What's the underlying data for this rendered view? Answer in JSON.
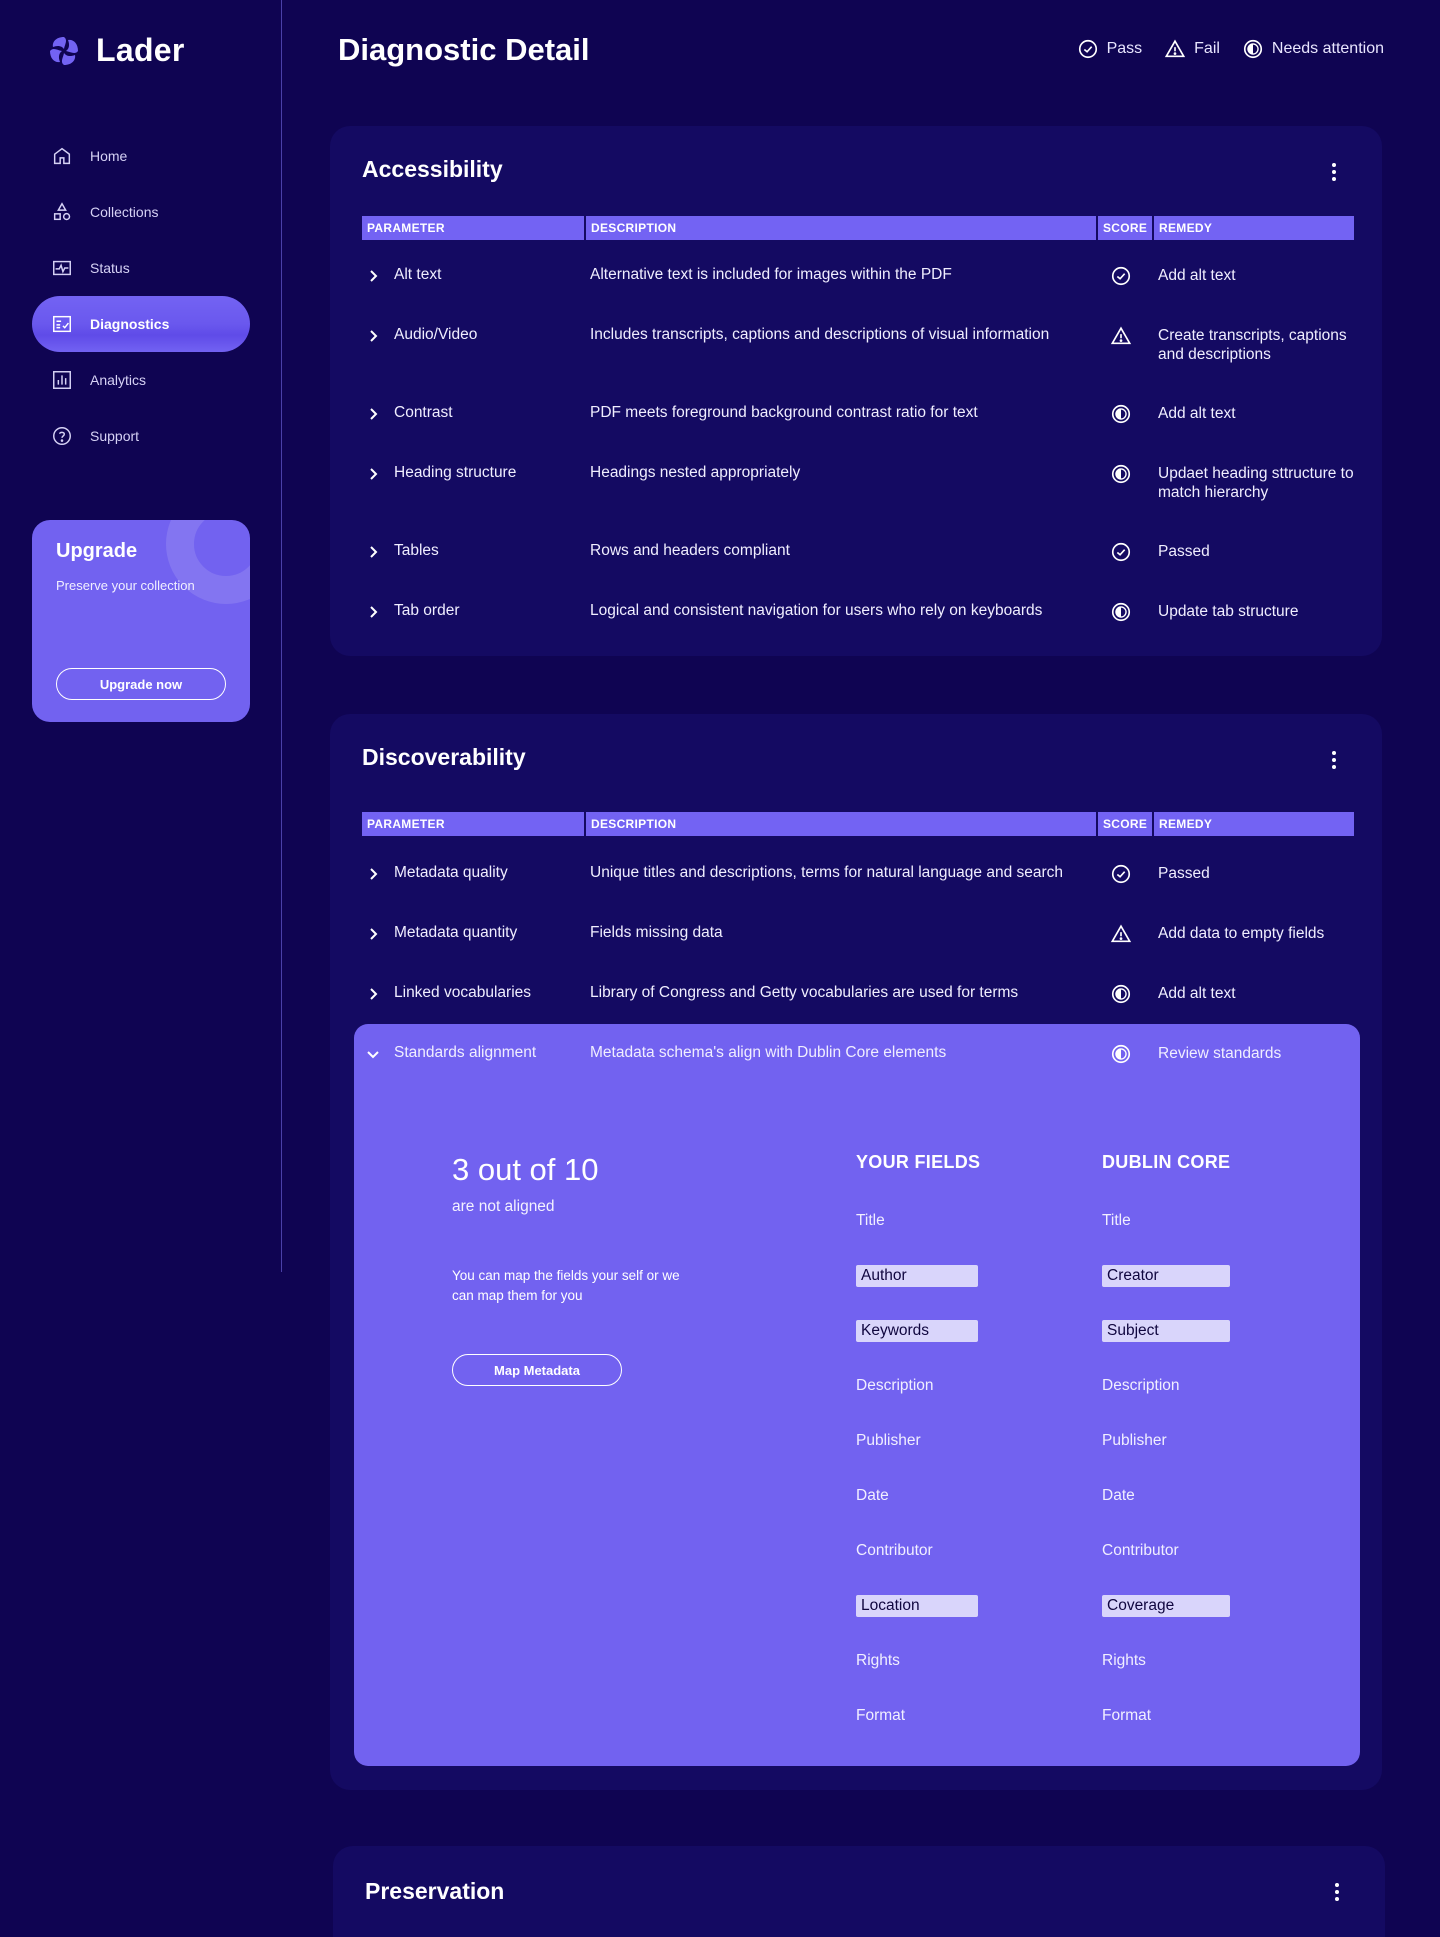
{
  "brand": {
    "name": "Lader"
  },
  "nav": [
    {
      "label": "Home",
      "icon": "home-icon",
      "active": false
    },
    {
      "label": "Collections",
      "icon": "shapes-icon",
      "active": false
    },
    {
      "label": "Status",
      "icon": "activity-icon",
      "active": false
    },
    {
      "label": "Diagnostics",
      "icon": "checklist-icon",
      "active": true
    },
    {
      "label": "Analytics",
      "icon": "bar-chart-icon",
      "active": false
    },
    {
      "label": "Support",
      "icon": "help-icon",
      "active": false
    }
  ],
  "upgrade": {
    "title": "Upgrade",
    "subtitle": "Preserve your collection",
    "button": "Upgrade now"
  },
  "header": {
    "title": "Diagnostic Detail",
    "legend": [
      {
        "label": "Pass",
        "icon": "check-circle-icon"
      },
      {
        "label": "Fail",
        "icon": "warning-triangle-icon"
      },
      {
        "label": "Needs attention",
        "icon": "half-circle-icon"
      }
    ]
  },
  "columns": {
    "parameter": "PARAMETER",
    "description": "DESCRIPTION",
    "score": "SCORE",
    "remedy": "REMEDY"
  },
  "accessibility": {
    "title": "Accessibility",
    "rows": [
      {
        "parameter": "Alt text",
        "description": "Alternative text is included for images within the PDF",
        "score": "pass",
        "remedy": "Add alt text"
      },
      {
        "parameter": "Audio/Video",
        "description": "Includes transcripts, captions and descriptions of visual information",
        "score": "fail",
        "remedy": "Create transcripts, captions and descriptions"
      },
      {
        "parameter": "Contrast",
        "description": "PDF meets foreground background contrast ratio for text",
        "score": "attention",
        "remedy": "Add alt text"
      },
      {
        "parameter": "Heading structure",
        "description": "Headings nested appropriately",
        "score": "attention",
        "remedy": "Updaet heading sttructure to match hierarchy"
      },
      {
        "parameter": "Tables",
        "description": "Rows and headers compliant",
        "score": "pass",
        "remedy": "Passed"
      },
      {
        "parameter": "Tab order",
        "description": "Logical and consistent navigation for users who rely on keyboards",
        "score": "attention",
        "remedy": "Update tab structure"
      }
    ]
  },
  "discoverability": {
    "title": "Discoverability",
    "rows": [
      {
        "parameter": "Metadata quality",
        "description": "Unique titles and descriptions, terms for  natural language and search",
        "score": "pass",
        "remedy": "Passed"
      },
      {
        "parameter": "Metadata quantity",
        "description": "Fields missing data",
        "score": "fail",
        "remedy": "Add data to empty fields"
      },
      {
        "parameter": "Linked vocabularies",
        "description": "Library of Congress and Getty vocabularies are used for terms",
        "score": "attention",
        "remedy": "Add alt text"
      },
      {
        "parameter": "Standards alignment",
        "description": "Metadata schema's align with Dublin Core elements",
        "score": "attention",
        "remedy": "Review standards",
        "expanded": true
      }
    ],
    "alignment": {
      "stat": "3 out of 10",
      "stat_sub": "are not aligned",
      "note": "You can map the fields your self or we can map them for you",
      "button": "Map Metadata",
      "your_fields_heading": "YOUR FIELDS",
      "dublin_core_heading": "DUBLIN CORE",
      "fields": [
        {
          "yours": "Title",
          "dublin": "Title",
          "mismatch": false
        },
        {
          "yours": "Author",
          "dublin": "Creator",
          "mismatch": true
        },
        {
          "yours": "Keywords",
          "dublin": "Subject",
          "mismatch": true
        },
        {
          "yours": "Description",
          "dublin": "Description",
          "mismatch": false
        },
        {
          "yours": "Publisher",
          "dublin": "Publisher",
          "mismatch": false
        },
        {
          "yours": "Date",
          "dublin": "Date",
          "mismatch": false
        },
        {
          "yours": "Contributor",
          "dublin": "Contributor",
          "mismatch": false
        },
        {
          "yours": "Location",
          "dublin": "Coverage",
          "mismatch": true
        },
        {
          "yours": "Rights",
          "dublin": "Rights",
          "mismatch": false
        },
        {
          "yours": "Format",
          "dublin": "Format",
          "mismatch": false
        }
      ]
    }
  },
  "preservation": {
    "title": "Preservation"
  },
  "colors": {
    "background": "#0f0452",
    "card": "#140a62",
    "accent": "#7363f3",
    "mismatch_highlight": "#d9d5fb"
  }
}
